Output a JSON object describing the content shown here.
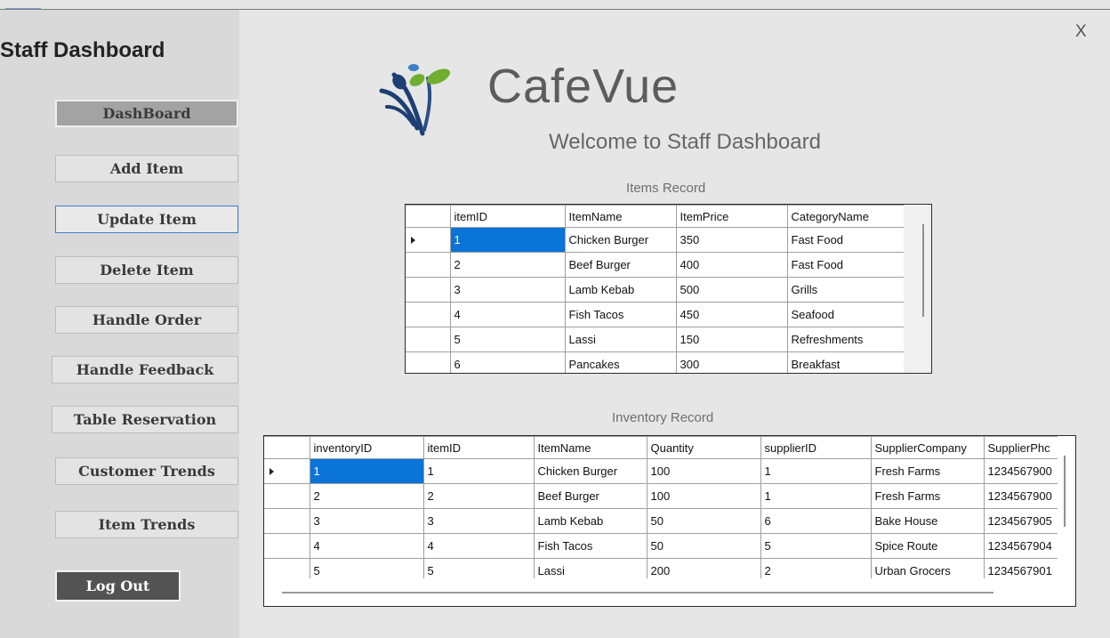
{
  "window": {
    "close_label": "X"
  },
  "sidebar": {
    "title": "Staff Dashboard",
    "items": [
      {
        "label": "DashBoard"
      },
      {
        "label": "Add Item"
      },
      {
        "label": "Update Item"
      },
      {
        "label": "Delete Item"
      },
      {
        "label": "Handle Order"
      },
      {
        "label": "Handle Feedback"
      },
      {
        "label": "Table Reservation"
      },
      {
        "label": "Customer Trends"
      },
      {
        "label": "Item Trends"
      }
    ],
    "logout_label": "Log Out"
  },
  "header": {
    "brand": "CafeVue",
    "welcome": "Welcome to Staff Dashboard",
    "logo_icon": "fork-spoon-leaf-logo"
  },
  "items_record": {
    "caption": "Items Record",
    "columns": [
      "itemID",
      "ItemName",
      "ItemPrice",
      "CategoryName"
    ],
    "rows": [
      [
        "1",
        "Chicken Burger",
        "350",
        "Fast Food"
      ],
      [
        "2",
        "Beef Burger",
        "400",
        "Fast Food"
      ],
      [
        "3",
        "Lamb Kebab",
        "500",
        "Grills"
      ],
      [
        "4",
        "Fish Tacos",
        "450",
        "Seafood"
      ],
      [
        "5",
        "Lassi",
        "150",
        "Refreshments"
      ],
      [
        "6",
        "Pancakes",
        "300",
        "Breakfast"
      ]
    ]
  },
  "inventory_record": {
    "caption": "Inventory Record",
    "columns": [
      "inventoryID",
      "itemID",
      "ItemName",
      "Quantity",
      "supplierID",
      "SupplierCompany",
      "SupplierPhc"
    ],
    "rows": [
      [
        "1",
        "1",
        "Chicken Burger",
        "100",
        "1",
        "Fresh Farms",
        "1234567900"
      ],
      [
        "2",
        "2",
        "Beef Burger",
        "100",
        "1",
        "Fresh Farms",
        "1234567900"
      ],
      [
        "3",
        "3",
        "Lamb Kebab",
        "50",
        "6",
        "Bake House",
        "1234567905"
      ],
      [
        "4",
        "4",
        "Fish Tacos",
        "50",
        "5",
        "Spice Route",
        "1234567904"
      ],
      [
        "5",
        "5",
        "Lassi",
        "200",
        "2",
        "Urban Grocers",
        "1234567901"
      ]
    ]
  },
  "colors": {
    "selection": "#0a74d9",
    "sidebar": "#d9d9d9",
    "logout": "#535353",
    "logo_blue": "#1d3f73",
    "logo_green": "#6fae2e"
  }
}
